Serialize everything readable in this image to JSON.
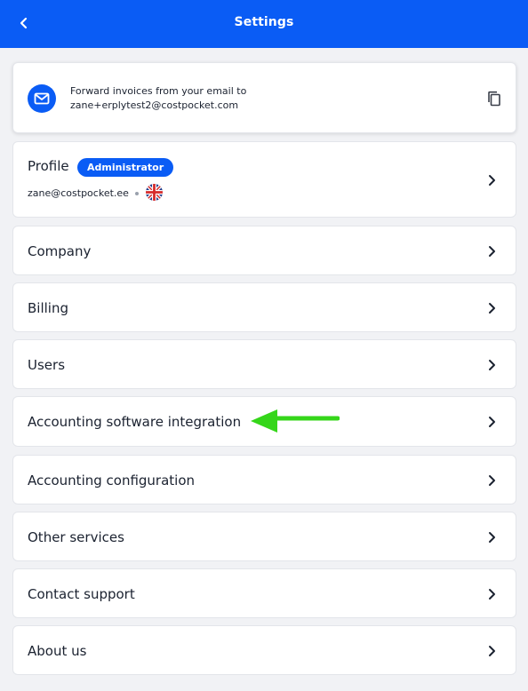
{
  "header": {
    "title": "Settings",
    "back_icon": "chevron-left-icon"
  },
  "forward": {
    "line1": "Forward invoices from your email to",
    "line2": "zane+erplytest2@costpocket.com",
    "mail_icon": "mail-icon",
    "copy_icon": "copy-icon"
  },
  "profile": {
    "title": "Profile",
    "badge": "Administrator",
    "email": "zane@costpocket.ee",
    "flag_icon": "uk-flag-icon"
  },
  "menu": [
    {
      "label": "Company"
    },
    {
      "label": "Billing"
    },
    {
      "label": "Users"
    },
    {
      "label": "Accounting software integration"
    },
    {
      "label": "Accounting configuration"
    },
    {
      "label": "Other services"
    },
    {
      "label": "Contact support"
    },
    {
      "label": "About us"
    }
  ],
  "annotation": {
    "arrow_color": "#35d61a",
    "arrow_icon": "green-arrow-icon"
  },
  "colors": {
    "brand": "#0a5cf5",
    "background": "#f1f2f5"
  }
}
